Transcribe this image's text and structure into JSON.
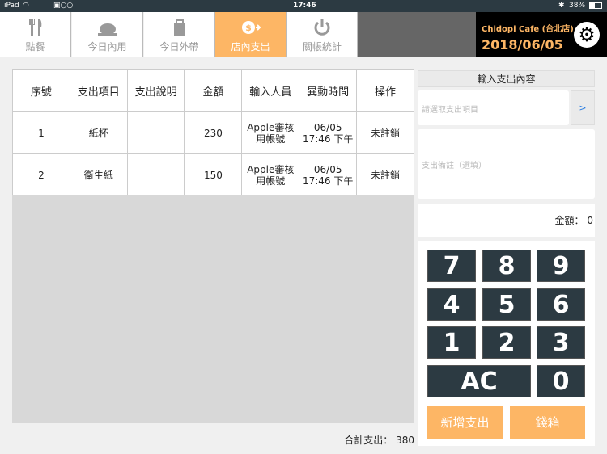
{
  "status": {
    "device": "iPad",
    "time": "17:46",
    "battery": "38%"
  },
  "tabs": [
    {
      "label": "點餐",
      "icon": "utensils-icon"
    },
    {
      "label": "今日內用",
      "icon": "roast-chicken-icon"
    },
    {
      "label": "今日外帶",
      "icon": "bag-icon"
    },
    {
      "label": "店內支出",
      "icon": "dollar-out-icon"
    },
    {
      "label": "關帳統計",
      "icon": "power-icon"
    }
  ],
  "store": {
    "name": "Chidopi Cafe (台北店)",
    "date": "2018/06/05"
  },
  "table": {
    "headers": [
      "序號",
      "支出項目",
      "支出說明",
      "金額",
      "輸入人員",
      "異動時間",
      "操作"
    ],
    "rows": [
      [
        "1",
        "紙杯",
        "",
        "230",
        "Apple審核用帳號",
        "06/05 17:46 下午",
        "未註銷"
      ],
      [
        "2",
        "衛生紙",
        "",
        "150",
        "Apple審核用帳號",
        "06/05 17:46 下午",
        "未註銷"
      ]
    ]
  },
  "total": {
    "label": "合計支出：",
    "value": "380"
  },
  "panel": {
    "title": "輸入支出內容",
    "item_placeholder": "請選取支出項目",
    "item_button": ">",
    "note_placeholder": "支出備註（選填）",
    "amount_label": "金額：",
    "amount_value": "0"
  },
  "keypad": {
    "keys": [
      "7",
      "8",
      "9",
      "4",
      "5",
      "6",
      "1",
      "2",
      "3"
    ],
    "clear": "AC",
    "zero": "0",
    "add": "新增支出",
    "cashbox": "錢箱"
  },
  "colors": {
    "accent": "#fdb665",
    "dark": "#2c3a42"
  }
}
